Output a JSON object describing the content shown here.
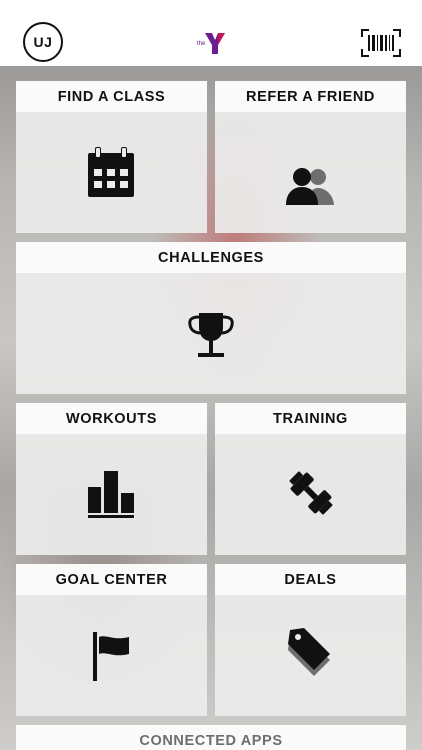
{
  "header": {
    "avatar_initials": "UJ",
    "logo_text": "the",
    "logo_icon": "ymca-y-logo",
    "barcode_icon": "barcode-icon"
  },
  "tiles": [
    {
      "label": "FIND A CLASS",
      "icon": "calendar-icon"
    },
    {
      "label": "REFER A FRIEND",
      "icon": "people-icon"
    },
    {
      "label": "CHALLENGES",
      "icon": "trophy-icon"
    },
    {
      "label": "WORKOUTS",
      "icon": "bar-chart-icon"
    },
    {
      "label": "TRAINING",
      "icon": "dumbbell-icon"
    },
    {
      "label": "GOAL CENTER",
      "icon": "flag-icon"
    },
    {
      "label": "DEALS",
      "icon": "tag-icon"
    },
    {
      "label": "CONNECTED APPS",
      "icon": ""
    }
  ],
  "colors": {
    "logo_purple": "#6b1e8f",
    "logo_magenta": "#c2185b",
    "icon": "#111111"
  }
}
